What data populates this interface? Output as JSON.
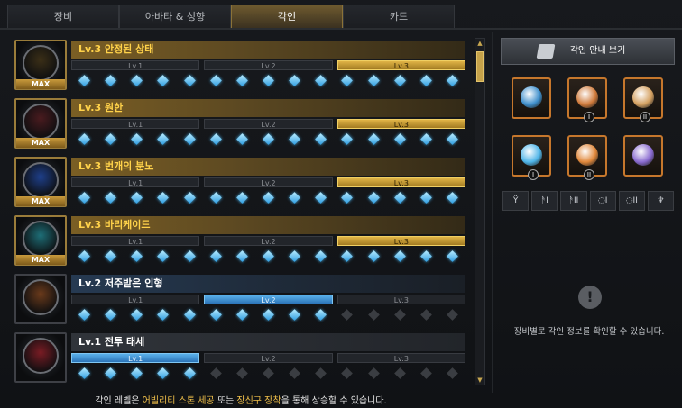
{
  "tabs": [
    "장비",
    "아바타 & 성향",
    "각인",
    "카드"
  ],
  "levels": [
    "Lv.1",
    "Lv.2",
    "Lv.3"
  ],
  "engravings": [
    {
      "title": "Lv.3 안정된 상태",
      "state": "max",
      "badge": "MAX",
      "level": 3,
      "gems_on": 15,
      "art": "#3b2f17"
    },
    {
      "title": "Lv.3 원한",
      "state": "max",
      "badge": "MAX",
      "level": 3,
      "gems_on": 15,
      "art": "#4a1b1f"
    },
    {
      "title": "Lv.3 번개의 분노",
      "state": "max",
      "badge": "MAX",
      "level": 3,
      "gems_on": 15,
      "art": "#1e3f8a"
    },
    {
      "title": "Lv.3 바리케이드",
      "state": "max",
      "badge": "MAX",
      "level": 3,
      "gems_on": 15,
      "art": "#1e6f78"
    },
    {
      "title": "Lv.2 저주받은 인형",
      "state": "mid",
      "badge": "",
      "level": 2,
      "gems_on": 10,
      "art": "#6a3a1b"
    },
    {
      "title": "Lv.1 전투 태세",
      "state": "low",
      "badge": "",
      "level": 1,
      "gems_on": 5,
      "art": "#7a1c24"
    }
  ],
  "guide_label": "각인 안내 보기",
  "slots": [
    {
      "name": "necklace",
      "num": "",
      "art": "#3e8fcc"
    },
    {
      "name": "earring-1",
      "num": "I",
      "art": "#d07a3a"
    },
    {
      "name": "earring-2",
      "num": "II",
      "art": "#d4a060"
    },
    {
      "name": "ring-1",
      "num": "I",
      "art": "#4fb5e8"
    },
    {
      "name": "ring-2",
      "num": "II",
      "art": "#e0873a"
    },
    {
      "name": "stone",
      "num": "",
      "art": "#8a6bd0"
    }
  ],
  "equip_tabs": [
    "Ϋ",
    "ᚫI",
    "ᚫII",
    "◌I",
    "◌II",
    "♆"
  ],
  "info_symbol": "!",
  "info_text": "장비별로 각인 정보를 확인할 수 있습니다.",
  "footer": {
    "a": "각인 레벨은 ",
    "b": "어빌리티 스톤 세공",
    "c": " 또는 ",
    "d": "장신구 장착",
    "e": "을 통해 상승할 수 있습니다."
  },
  "scroll": {
    "up": "▲",
    "down": "▼"
  }
}
